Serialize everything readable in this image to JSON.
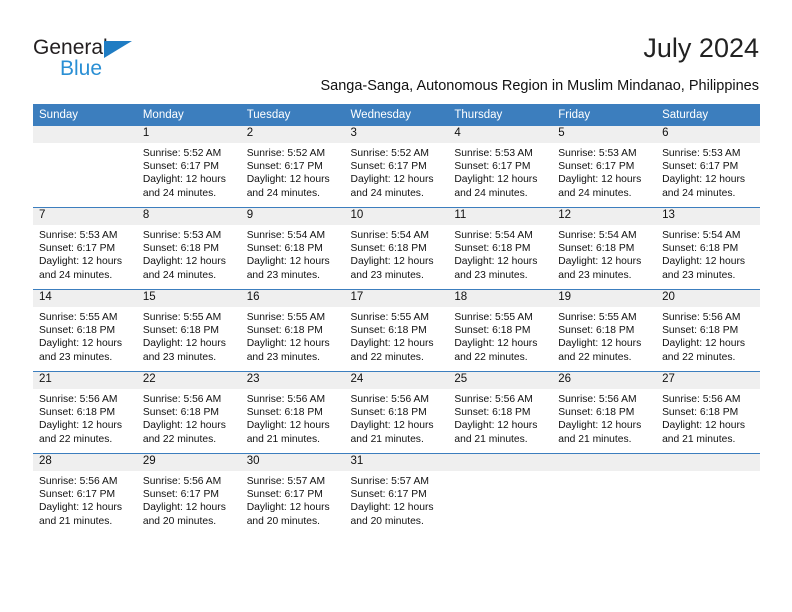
{
  "logo": {
    "word_top": "General",
    "word_bottom": "Blue",
    "triangle_color": "#1f7cc3",
    "blue_color": "#2a8fd4"
  },
  "header": {
    "title": "July 2024",
    "subtitle": "Sanga-Sanga, Autonomous Region in Muslim Mindanao, Philippines"
  },
  "theme": {
    "header_bg": "#3c7ebe",
    "daynum_bg": "#efefef",
    "row_divider": "#3c7ebe",
    "text": "#111111"
  },
  "calendar": {
    "weekday_headers": [
      "Sunday",
      "Monday",
      "Tuesday",
      "Wednesday",
      "Thursday",
      "Friday",
      "Saturday"
    ],
    "weeks": [
      [
        {
          "day": "",
          "sunrise": "",
          "sunset": "",
          "daylight1": "",
          "daylight2": ""
        },
        {
          "day": "1",
          "sunrise": "Sunrise: 5:52 AM",
          "sunset": "Sunset: 6:17 PM",
          "daylight1": "Daylight: 12 hours",
          "daylight2": "and 24 minutes."
        },
        {
          "day": "2",
          "sunrise": "Sunrise: 5:52 AM",
          "sunset": "Sunset: 6:17 PM",
          "daylight1": "Daylight: 12 hours",
          "daylight2": "and 24 minutes."
        },
        {
          "day": "3",
          "sunrise": "Sunrise: 5:52 AM",
          "sunset": "Sunset: 6:17 PM",
          "daylight1": "Daylight: 12 hours",
          "daylight2": "and 24 minutes."
        },
        {
          "day": "4",
          "sunrise": "Sunrise: 5:53 AM",
          "sunset": "Sunset: 6:17 PM",
          "daylight1": "Daylight: 12 hours",
          "daylight2": "and 24 minutes."
        },
        {
          "day": "5",
          "sunrise": "Sunrise: 5:53 AM",
          "sunset": "Sunset: 6:17 PM",
          "daylight1": "Daylight: 12 hours",
          "daylight2": "and 24 minutes."
        },
        {
          "day": "6",
          "sunrise": "Sunrise: 5:53 AM",
          "sunset": "Sunset: 6:17 PM",
          "daylight1": "Daylight: 12 hours",
          "daylight2": "and 24 minutes."
        }
      ],
      [
        {
          "day": "7",
          "sunrise": "Sunrise: 5:53 AM",
          "sunset": "Sunset: 6:17 PM",
          "daylight1": "Daylight: 12 hours",
          "daylight2": "and 24 minutes."
        },
        {
          "day": "8",
          "sunrise": "Sunrise: 5:53 AM",
          "sunset": "Sunset: 6:18 PM",
          "daylight1": "Daylight: 12 hours",
          "daylight2": "and 24 minutes."
        },
        {
          "day": "9",
          "sunrise": "Sunrise: 5:54 AM",
          "sunset": "Sunset: 6:18 PM",
          "daylight1": "Daylight: 12 hours",
          "daylight2": "and 23 minutes."
        },
        {
          "day": "10",
          "sunrise": "Sunrise: 5:54 AM",
          "sunset": "Sunset: 6:18 PM",
          "daylight1": "Daylight: 12 hours",
          "daylight2": "and 23 minutes."
        },
        {
          "day": "11",
          "sunrise": "Sunrise: 5:54 AM",
          "sunset": "Sunset: 6:18 PM",
          "daylight1": "Daylight: 12 hours",
          "daylight2": "and 23 minutes."
        },
        {
          "day": "12",
          "sunrise": "Sunrise: 5:54 AM",
          "sunset": "Sunset: 6:18 PM",
          "daylight1": "Daylight: 12 hours",
          "daylight2": "and 23 minutes."
        },
        {
          "day": "13",
          "sunrise": "Sunrise: 5:54 AM",
          "sunset": "Sunset: 6:18 PM",
          "daylight1": "Daylight: 12 hours",
          "daylight2": "and 23 minutes."
        }
      ],
      [
        {
          "day": "14",
          "sunrise": "Sunrise: 5:55 AM",
          "sunset": "Sunset: 6:18 PM",
          "daylight1": "Daylight: 12 hours",
          "daylight2": "and 23 minutes."
        },
        {
          "day": "15",
          "sunrise": "Sunrise: 5:55 AM",
          "sunset": "Sunset: 6:18 PM",
          "daylight1": "Daylight: 12 hours",
          "daylight2": "and 23 minutes."
        },
        {
          "day": "16",
          "sunrise": "Sunrise: 5:55 AM",
          "sunset": "Sunset: 6:18 PM",
          "daylight1": "Daylight: 12 hours",
          "daylight2": "and 23 minutes."
        },
        {
          "day": "17",
          "sunrise": "Sunrise: 5:55 AM",
          "sunset": "Sunset: 6:18 PM",
          "daylight1": "Daylight: 12 hours",
          "daylight2": "and 22 minutes."
        },
        {
          "day": "18",
          "sunrise": "Sunrise: 5:55 AM",
          "sunset": "Sunset: 6:18 PM",
          "daylight1": "Daylight: 12 hours",
          "daylight2": "and 22 minutes."
        },
        {
          "day": "19",
          "sunrise": "Sunrise: 5:55 AM",
          "sunset": "Sunset: 6:18 PM",
          "daylight1": "Daylight: 12 hours",
          "daylight2": "and 22 minutes."
        },
        {
          "day": "20",
          "sunrise": "Sunrise: 5:56 AM",
          "sunset": "Sunset: 6:18 PM",
          "daylight1": "Daylight: 12 hours",
          "daylight2": "and 22 minutes."
        }
      ],
      [
        {
          "day": "21",
          "sunrise": "Sunrise: 5:56 AM",
          "sunset": "Sunset: 6:18 PM",
          "daylight1": "Daylight: 12 hours",
          "daylight2": "and 22 minutes."
        },
        {
          "day": "22",
          "sunrise": "Sunrise: 5:56 AM",
          "sunset": "Sunset: 6:18 PM",
          "daylight1": "Daylight: 12 hours",
          "daylight2": "and 22 minutes."
        },
        {
          "day": "23",
          "sunrise": "Sunrise: 5:56 AM",
          "sunset": "Sunset: 6:18 PM",
          "daylight1": "Daylight: 12 hours",
          "daylight2": "and 21 minutes."
        },
        {
          "day": "24",
          "sunrise": "Sunrise: 5:56 AM",
          "sunset": "Sunset: 6:18 PM",
          "daylight1": "Daylight: 12 hours",
          "daylight2": "and 21 minutes."
        },
        {
          "day": "25",
          "sunrise": "Sunrise: 5:56 AM",
          "sunset": "Sunset: 6:18 PM",
          "daylight1": "Daylight: 12 hours",
          "daylight2": "and 21 minutes."
        },
        {
          "day": "26",
          "sunrise": "Sunrise: 5:56 AM",
          "sunset": "Sunset: 6:18 PM",
          "daylight1": "Daylight: 12 hours",
          "daylight2": "and 21 minutes."
        },
        {
          "day": "27",
          "sunrise": "Sunrise: 5:56 AM",
          "sunset": "Sunset: 6:18 PM",
          "daylight1": "Daylight: 12 hours",
          "daylight2": "and 21 minutes."
        }
      ],
      [
        {
          "day": "28",
          "sunrise": "Sunrise: 5:56 AM",
          "sunset": "Sunset: 6:17 PM",
          "daylight1": "Daylight: 12 hours",
          "daylight2": "and 21 minutes."
        },
        {
          "day": "29",
          "sunrise": "Sunrise: 5:56 AM",
          "sunset": "Sunset: 6:17 PM",
          "daylight1": "Daylight: 12 hours",
          "daylight2": "and 20 minutes."
        },
        {
          "day": "30",
          "sunrise": "Sunrise: 5:57 AM",
          "sunset": "Sunset: 6:17 PM",
          "daylight1": "Daylight: 12 hours",
          "daylight2": "and 20 minutes."
        },
        {
          "day": "31",
          "sunrise": "Sunrise: 5:57 AM",
          "sunset": "Sunset: 6:17 PM",
          "daylight1": "Daylight: 12 hours",
          "daylight2": "and 20 minutes."
        },
        {
          "day": "",
          "sunrise": "",
          "sunset": "",
          "daylight1": "",
          "daylight2": ""
        },
        {
          "day": "",
          "sunrise": "",
          "sunset": "",
          "daylight1": "",
          "daylight2": ""
        },
        {
          "day": "",
          "sunrise": "",
          "sunset": "",
          "daylight1": "",
          "daylight2": ""
        }
      ]
    ]
  }
}
